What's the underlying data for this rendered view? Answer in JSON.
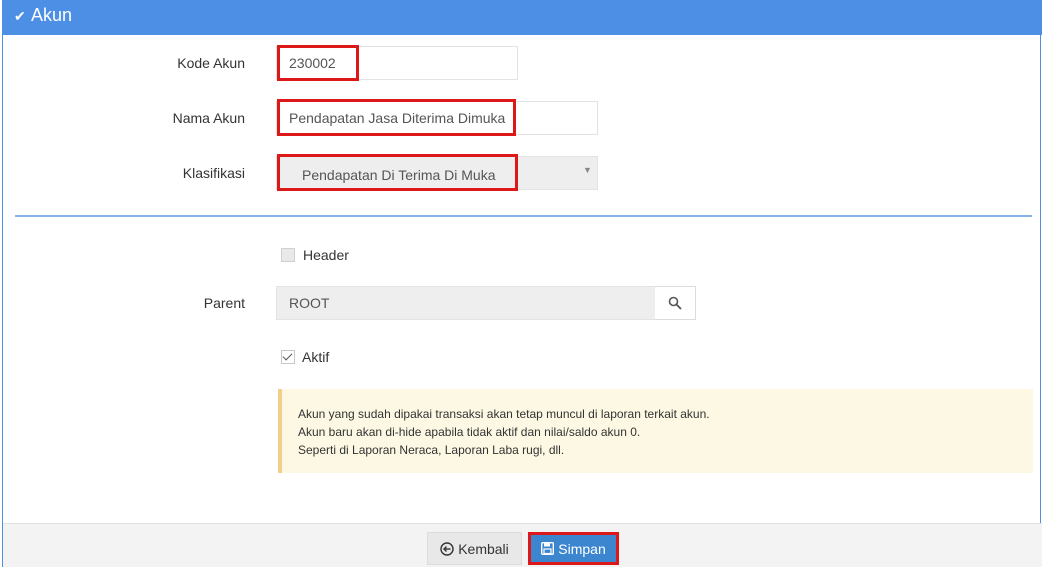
{
  "panel": {
    "title": "Akun",
    "check_icon": "check-icon"
  },
  "form": {
    "kode_akun": {
      "label": "Kode Akun",
      "value": "230002"
    },
    "nama_akun": {
      "label": "Nama Akun",
      "value": "Pendapatan Jasa Diterima Dimuka"
    },
    "klasifikasi": {
      "label": "Klasifikasi",
      "value": "Pendapatan Di Terima Di Muka"
    },
    "header": {
      "label": "Header",
      "checked": false
    },
    "parent": {
      "label": "Parent",
      "value": "ROOT",
      "search_icon": "search-icon"
    },
    "aktif": {
      "label": "Aktif",
      "checked": true
    }
  },
  "info": {
    "lines": [
      "Akun yang sudah dipakai transaksi akan tetap muncul di laporan terkait akun.",
      "Akun baru akan di-hide apabila tidak aktif dan nilai/saldo akun 0.",
      "Seperti di Laporan Neraca, Laporan Laba rugi, dll."
    ]
  },
  "footer": {
    "back_label": "Kembali",
    "save_label": "Simpan"
  },
  "colors": {
    "header_bg": "#4e8fe6",
    "save_bg": "#3b86cf",
    "highlight": "#dd1818",
    "alert_bg": "#fcf8e3"
  }
}
